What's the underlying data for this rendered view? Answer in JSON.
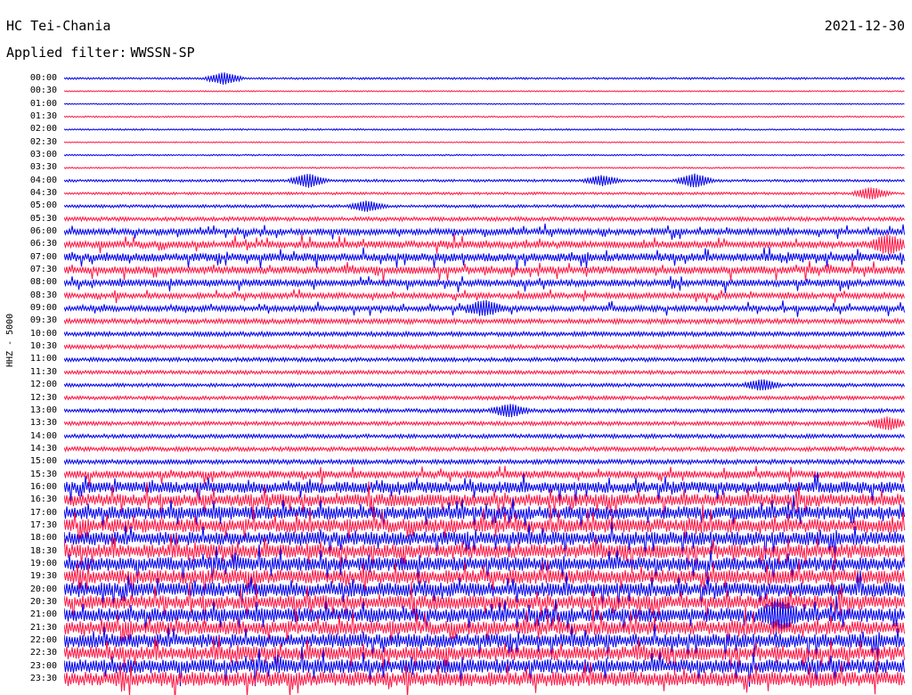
{
  "header": {
    "station": "HC Tei-Chania",
    "date": "2021-12-30",
    "filter_label": "Applied filter:",
    "filter_value": "WWSSN-SP"
  },
  "axis": {
    "channel_label": "HHZ - 5000"
  },
  "chart_data": {
    "type": "line",
    "title": "HC Tei-Chania",
    "ylabel": "HHZ - 5000",
    "row_labels": [
      "00:00",
      "00:30",
      "01:00",
      "01:30",
      "02:00",
      "02:30",
      "03:00",
      "03:30",
      "04:00",
      "04:30",
      "05:00",
      "05:30",
      "06:00",
      "06:30",
      "07:00",
      "07:30",
      "08:00",
      "08:30",
      "09:00",
      "09:30",
      "10:00",
      "10:30",
      "11:00",
      "11:30",
      "12:00",
      "12:30",
      "13:00",
      "13:30",
      "14:00",
      "14:30",
      "15:00",
      "15:30",
      "16:00",
      "16:30",
      "17:00",
      "17:30",
      "18:00",
      "18:30",
      "19:00",
      "19:30",
      "20:00",
      "20:30",
      "21:00",
      "21:30",
      "22:00",
      "22:30",
      "23:00",
      "23:30"
    ],
    "colors": [
      "#0000ee",
      "#ff1744"
    ],
    "activity_level": [
      0.8,
      0.5,
      0.5,
      0.6,
      0.6,
      0.5,
      0.6,
      0.6,
      1.0,
      1.0,
      1.2,
      1.6,
      2.4,
      2.8,
      3.2,
      3.0,
      2.6,
      2.2,
      2.2,
      2.0,
      1.8,
      1.6,
      1.6,
      1.5,
      1.4,
      1.5,
      1.6,
      1.6,
      1.6,
      1.7,
      1.8,
      3.0,
      4.5,
      5.0,
      5.2,
      5.4,
      5.4,
      5.5,
      5.5,
      5.6,
      5.6,
      5.6,
      5.6,
      5.5,
      5.5,
      5.5,
      5.6,
      5.8
    ],
    "events": [
      {
        "row": 0,
        "x": 0.19,
        "amp": 6
      },
      {
        "row": 8,
        "x": 0.29,
        "amp": 7
      },
      {
        "row": 8,
        "x": 0.64,
        "amp": 5
      },
      {
        "row": 8,
        "x": 0.75,
        "amp": 7
      },
      {
        "row": 9,
        "x": 0.96,
        "amp": 6
      },
      {
        "row": 10,
        "x": 0.36,
        "amp": 5
      },
      {
        "row": 13,
        "x": 0.98,
        "amp": 8
      },
      {
        "row": 18,
        "x": 0.5,
        "amp": 7
      },
      {
        "row": 24,
        "x": 0.83,
        "amp": 5
      },
      {
        "row": 26,
        "x": 0.53,
        "amp": 6
      },
      {
        "row": 27,
        "x": 0.98,
        "amp": 6
      },
      {
        "row": 42,
        "x": 0.85,
        "amp": 12
      }
    ]
  }
}
